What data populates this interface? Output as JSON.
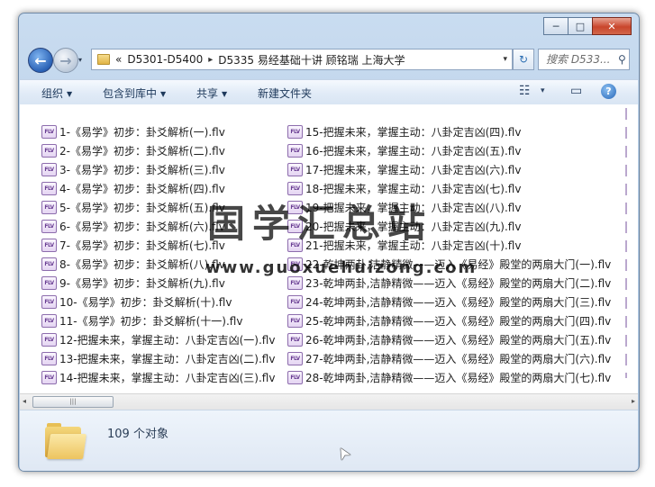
{
  "window": {
    "caption_buttons": {
      "minimize": "─",
      "maximize": "□",
      "close": "✕"
    }
  },
  "nav": {
    "back_glyph": "←",
    "forward_glyph": "→",
    "history_dropdown": "▾",
    "breadcrumb": [
      "«",
      "D5301-D5400",
      "D5335 易经基础十讲 顾铭瑞 上海大学"
    ],
    "breadcrumb_separator": "▸",
    "address_dropdown": "▾",
    "refresh_glyph": "↻",
    "search_placeholder": "搜索 D533..."
  },
  "toolbar": {
    "organize": "组织",
    "include_in_library": "包含到库中",
    "share": "共享",
    "new_folder": "新建文件夹",
    "views_glyph": "☷",
    "views_arrow": "▾",
    "preview_pane_glyph": "▭",
    "help_glyph": "?"
  },
  "files": {
    "icon_text": "FLV",
    "column1": [
      "1-《易学》初步：卦爻解析(一).flv",
      "2-《易学》初步：卦爻解析(二).flv",
      "3-《易学》初步：卦爻解析(三).flv",
      "4-《易学》初步：卦爻解析(四).flv",
      "5-《易学》初步：卦爻解析(五).flv",
      "6-《易学》初步：卦爻解析(六).flv",
      "7-《易学》初步：卦爻解析(七).flv",
      "8-《易学》初步：卦爻解析(八).flv",
      "9-《易学》初步：卦爻解析(九).flv",
      "10-《易学》初步：卦爻解析(十).flv",
      "11-《易学》初步：卦爻解析(十一).flv",
      "12-把握未来，掌握主动：八卦定吉凶(一).flv",
      "13-把握未来，掌握主动：八卦定吉凶(二).flv",
      "14-把握未来，掌握主动：八卦定吉凶(三).flv"
    ],
    "column2": [
      "15-把握未来，掌握主动：八卦定吉凶(四).flv",
      "16-把握未来，掌握主动：八卦定吉凶(五).flv",
      "17-把握未来，掌握主动：八卦定吉凶(六).flv",
      "18-把握未来，掌握主动：八卦定吉凶(七).flv",
      "19-把握未来，掌握主动：八卦定吉凶(八).flv",
      "20-把握未来，掌握主动：八卦定吉凶(九).flv",
      "21-把握未来，掌握主动：八卦定吉凶(十).flv",
      "22-乾坤两卦,洁静精微——迈入《易经》殿堂的两扇大门(一).flv",
      "23-乾坤两卦,洁静精微——迈入《易经》殿堂的两扇大门(二).flv",
      "24-乾坤两卦,洁静精微——迈入《易经》殿堂的两扇大门(三).flv",
      "25-乾坤两卦,洁静精微——迈入《易经》殿堂的两扇大门(四).flv",
      "26-乾坤两卦,洁静精微——迈入《易经》殿堂的两扇大门(五).flv",
      "27-乾坤两卦,洁静精微——迈入《易经》殿堂的两扇大门(六).flv",
      "28-乾坤两卦,洁静精微——迈入《易经》殿堂的两扇大门(七).flv"
    ]
  },
  "scrollbar": {
    "left_arrow": "◂",
    "right_arrow": "▸",
    "grip": "|||"
  },
  "details": {
    "count_text": "109 个对象"
  },
  "watermark": {
    "title": "国学汇总站",
    "url": "www.guoxuehuizong.com"
  },
  "cursor_glyph": "➤"
}
